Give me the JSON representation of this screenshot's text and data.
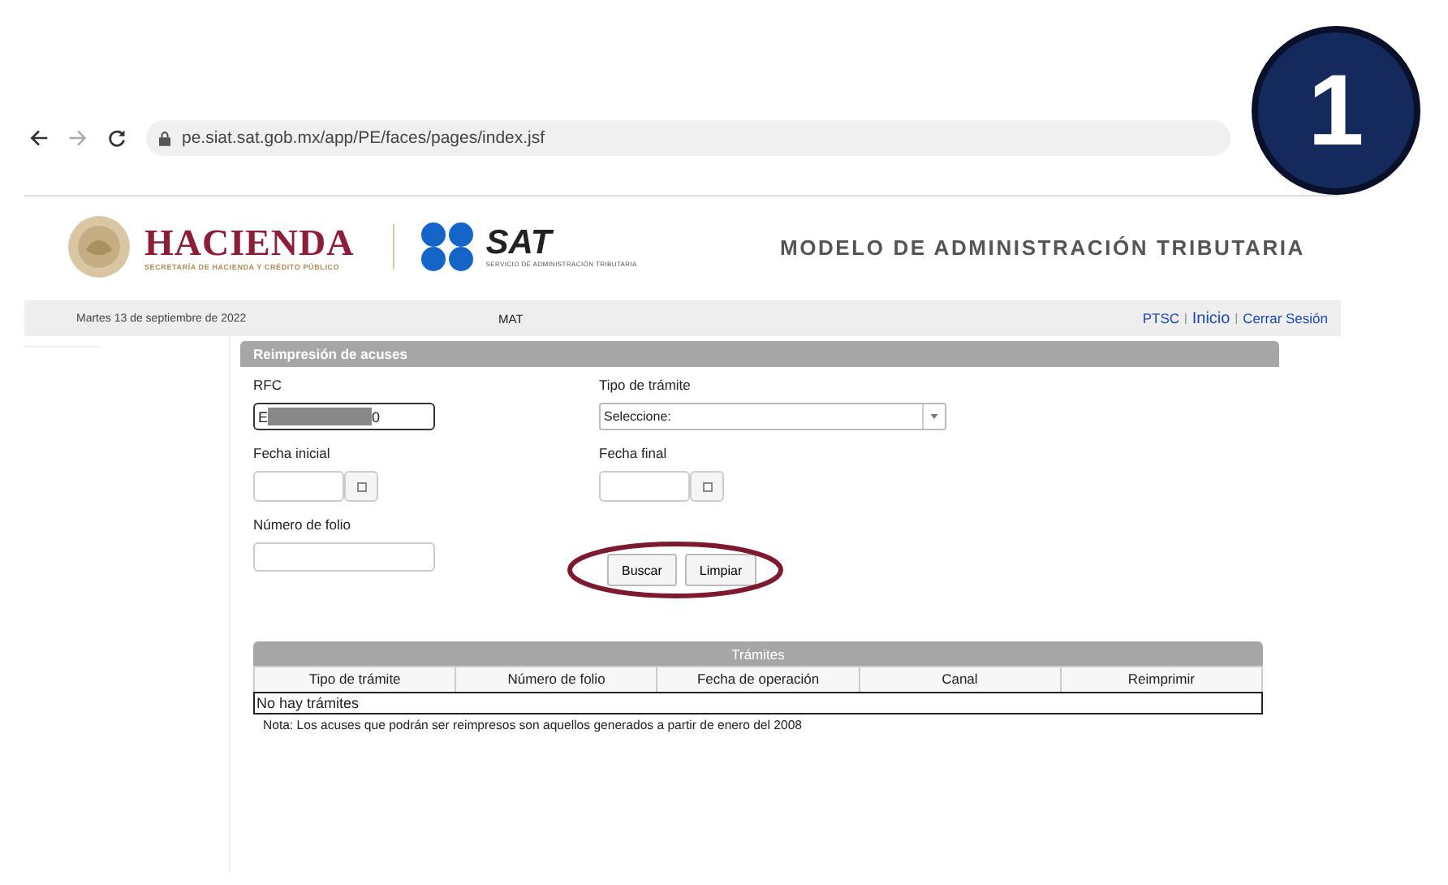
{
  "browser": {
    "url": "pe.siat.sat.gob.mx/app/PE/faces/pages/index.jsf"
  },
  "step_badge": "1",
  "header": {
    "hacienda": "HACIENDA",
    "hacienda_sub": "SECRETARÍA DE HACIENDA Y CRÉDITO PÚBLICO",
    "sat": "SAT",
    "sat_sub": "SERVICIO DE ADMINISTRACIÓN TRIBUTARIA",
    "title": "MODELO DE ADMINISTRACIÓN TRIBUTARIA"
  },
  "nav": {
    "date": "Martes 13 de septiembre de 2022",
    "center": "MAT",
    "links": [
      "PTSC",
      "Inicio",
      "Cerrar Sesión"
    ],
    "separators": [
      "|",
      "|"
    ]
  },
  "form": {
    "title": "Reimpresión de acuses",
    "rfc": {
      "label": "RFC",
      "value_start": "E",
      "value_end": "0",
      "redacted": true
    },
    "tipo": {
      "label": "Tipo de trámite",
      "value": "Seleccione:"
    },
    "fecha_inicial": {
      "label": "Fecha inicial"
    },
    "fecha_final": {
      "label": "Fecha final"
    },
    "folio": {
      "label": "Número de folio"
    },
    "buttons": [
      "Buscar",
      "Limpiar"
    ],
    "buttons_circled": true
  },
  "table": {
    "title": "Trámites",
    "columns": [
      "Tipo de trámite",
      "Número de folio",
      "Fecha de operación",
      "Canal",
      "Reimprimir"
    ],
    "empty": "No hay trámites"
  },
  "note": "Nota: Los acuses que podrán ser reimpresos son aquellos generados a partir de enero del 2008"
}
